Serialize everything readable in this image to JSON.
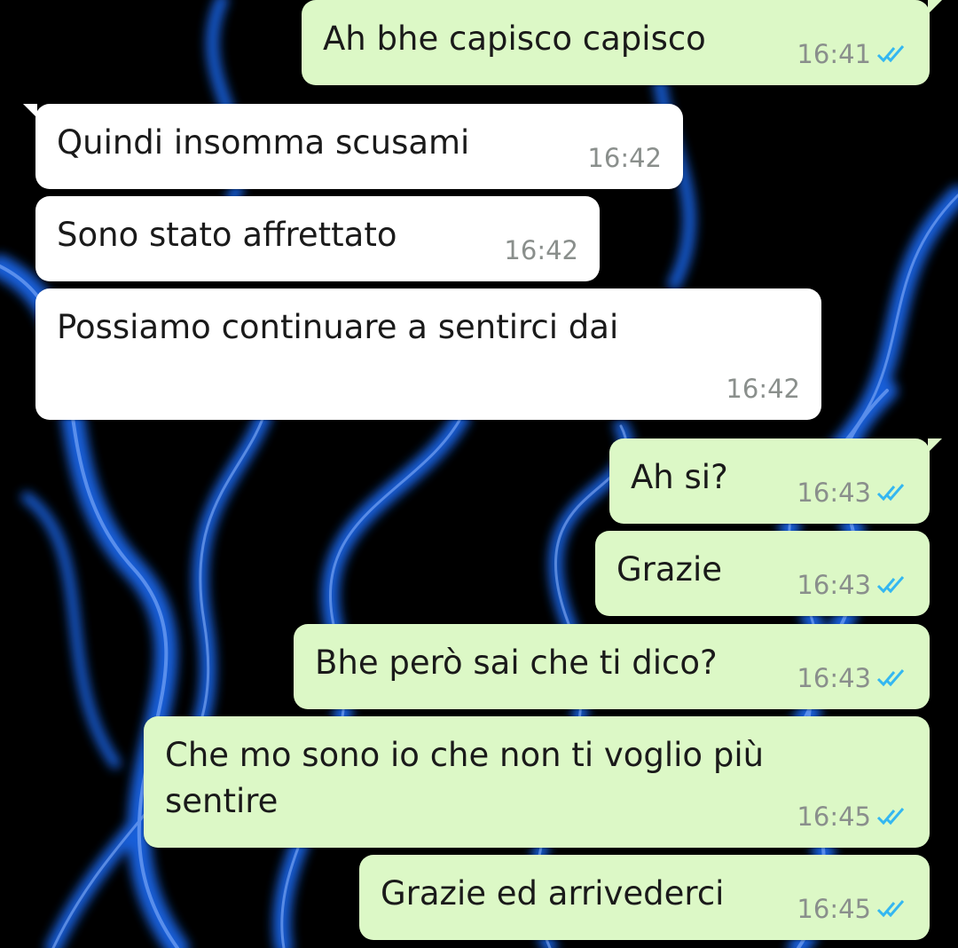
{
  "theme": {
    "outgoing_bubble": "#dcf8c6",
    "incoming_bubble": "#ffffff",
    "read_tick": "#34b7f1",
    "time_text": "#8a8f8c",
    "background": "#000000",
    "flame": "#1f6fff"
  },
  "messages": [
    {
      "text": "Ah bhe capisco capisco",
      "time": "16:41",
      "direction": "out",
      "status_icon": "double-check-read-icon"
    },
    {
      "text": "Quindi insomma scusami",
      "time": "16:42",
      "direction": "in"
    },
    {
      "text": "Sono stato affrettato",
      "time": "16:42",
      "direction": "in"
    },
    {
      "text": "Possiamo continuare a sentirci dai",
      "time": "16:42",
      "direction": "in"
    },
    {
      "text": "Ah si?",
      "time": "16:43",
      "direction": "out",
      "status_icon": "double-check-read-icon"
    },
    {
      "text": "Grazie",
      "time": "16:43",
      "direction": "out",
      "status_icon": "double-check-read-icon"
    },
    {
      "text": "Bhe però sai che ti dico?",
      "time": "16:43",
      "direction": "out",
      "status_icon": "double-check-read-icon"
    },
    {
      "text": "Che mo sono io che non ti voglio più\nsentire",
      "time": "16:45",
      "direction": "out",
      "status_icon": "double-check-read-icon"
    },
    {
      "text": "Grazie ed arrivederci",
      "time": "16:45",
      "direction": "out",
      "status_icon": "double-check-read-icon"
    }
  ]
}
